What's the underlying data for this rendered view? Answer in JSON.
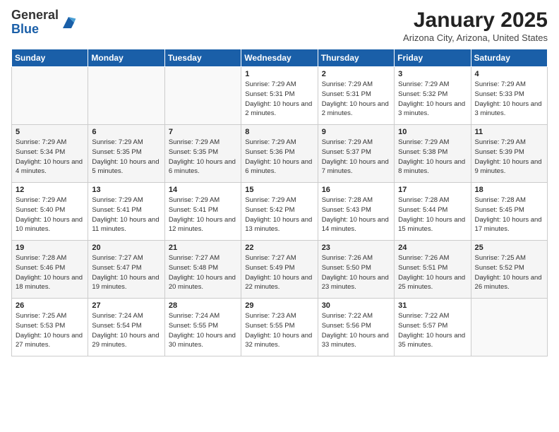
{
  "logo": {
    "general": "General",
    "blue": "Blue"
  },
  "title": "January 2025",
  "subtitle": "Arizona City, Arizona, United States",
  "headers": [
    "Sunday",
    "Monday",
    "Tuesday",
    "Wednesday",
    "Thursday",
    "Friday",
    "Saturday"
  ],
  "weeks": [
    [
      {
        "day": "",
        "sunrise": "",
        "sunset": "",
        "daylight": ""
      },
      {
        "day": "",
        "sunrise": "",
        "sunset": "",
        "daylight": ""
      },
      {
        "day": "",
        "sunrise": "",
        "sunset": "",
        "daylight": ""
      },
      {
        "day": "1",
        "sunrise": "Sunrise: 7:29 AM",
        "sunset": "Sunset: 5:31 PM",
        "daylight": "Daylight: 10 hours and 2 minutes."
      },
      {
        "day": "2",
        "sunrise": "Sunrise: 7:29 AM",
        "sunset": "Sunset: 5:31 PM",
        "daylight": "Daylight: 10 hours and 2 minutes."
      },
      {
        "day": "3",
        "sunrise": "Sunrise: 7:29 AM",
        "sunset": "Sunset: 5:32 PM",
        "daylight": "Daylight: 10 hours and 3 minutes."
      },
      {
        "day": "4",
        "sunrise": "Sunrise: 7:29 AM",
        "sunset": "Sunset: 5:33 PM",
        "daylight": "Daylight: 10 hours and 3 minutes."
      }
    ],
    [
      {
        "day": "5",
        "sunrise": "Sunrise: 7:29 AM",
        "sunset": "Sunset: 5:34 PM",
        "daylight": "Daylight: 10 hours and 4 minutes."
      },
      {
        "day": "6",
        "sunrise": "Sunrise: 7:29 AM",
        "sunset": "Sunset: 5:35 PM",
        "daylight": "Daylight: 10 hours and 5 minutes."
      },
      {
        "day": "7",
        "sunrise": "Sunrise: 7:29 AM",
        "sunset": "Sunset: 5:35 PM",
        "daylight": "Daylight: 10 hours and 6 minutes."
      },
      {
        "day": "8",
        "sunrise": "Sunrise: 7:29 AM",
        "sunset": "Sunset: 5:36 PM",
        "daylight": "Daylight: 10 hours and 6 minutes."
      },
      {
        "day": "9",
        "sunrise": "Sunrise: 7:29 AM",
        "sunset": "Sunset: 5:37 PM",
        "daylight": "Daylight: 10 hours and 7 minutes."
      },
      {
        "day": "10",
        "sunrise": "Sunrise: 7:29 AM",
        "sunset": "Sunset: 5:38 PM",
        "daylight": "Daylight: 10 hours and 8 minutes."
      },
      {
        "day": "11",
        "sunrise": "Sunrise: 7:29 AM",
        "sunset": "Sunset: 5:39 PM",
        "daylight": "Daylight: 10 hours and 9 minutes."
      }
    ],
    [
      {
        "day": "12",
        "sunrise": "Sunrise: 7:29 AM",
        "sunset": "Sunset: 5:40 PM",
        "daylight": "Daylight: 10 hours and 10 minutes."
      },
      {
        "day": "13",
        "sunrise": "Sunrise: 7:29 AM",
        "sunset": "Sunset: 5:41 PM",
        "daylight": "Daylight: 10 hours and 11 minutes."
      },
      {
        "day": "14",
        "sunrise": "Sunrise: 7:29 AM",
        "sunset": "Sunset: 5:41 PM",
        "daylight": "Daylight: 10 hours and 12 minutes."
      },
      {
        "day": "15",
        "sunrise": "Sunrise: 7:29 AM",
        "sunset": "Sunset: 5:42 PM",
        "daylight": "Daylight: 10 hours and 13 minutes."
      },
      {
        "day": "16",
        "sunrise": "Sunrise: 7:28 AM",
        "sunset": "Sunset: 5:43 PM",
        "daylight": "Daylight: 10 hours and 14 minutes."
      },
      {
        "day": "17",
        "sunrise": "Sunrise: 7:28 AM",
        "sunset": "Sunset: 5:44 PM",
        "daylight": "Daylight: 10 hours and 15 minutes."
      },
      {
        "day": "18",
        "sunrise": "Sunrise: 7:28 AM",
        "sunset": "Sunset: 5:45 PM",
        "daylight": "Daylight: 10 hours and 17 minutes."
      }
    ],
    [
      {
        "day": "19",
        "sunrise": "Sunrise: 7:28 AM",
        "sunset": "Sunset: 5:46 PM",
        "daylight": "Daylight: 10 hours and 18 minutes."
      },
      {
        "day": "20",
        "sunrise": "Sunrise: 7:27 AM",
        "sunset": "Sunset: 5:47 PM",
        "daylight": "Daylight: 10 hours and 19 minutes."
      },
      {
        "day": "21",
        "sunrise": "Sunrise: 7:27 AM",
        "sunset": "Sunset: 5:48 PM",
        "daylight": "Daylight: 10 hours and 20 minutes."
      },
      {
        "day": "22",
        "sunrise": "Sunrise: 7:27 AM",
        "sunset": "Sunset: 5:49 PM",
        "daylight": "Daylight: 10 hours and 22 minutes."
      },
      {
        "day": "23",
        "sunrise": "Sunrise: 7:26 AM",
        "sunset": "Sunset: 5:50 PM",
        "daylight": "Daylight: 10 hours and 23 minutes."
      },
      {
        "day": "24",
        "sunrise": "Sunrise: 7:26 AM",
        "sunset": "Sunset: 5:51 PM",
        "daylight": "Daylight: 10 hours and 25 minutes."
      },
      {
        "day": "25",
        "sunrise": "Sunrise: 7:25 AM",
        "sunset": "Sunset: 5:52 PM",
        "daylight": "Daylight: 10 hours and 26 minutes."
      }
    ],
    [
      {
        "day": "26",
        "sunrise": "Sunrise: 7:25 AM",
        "sunset": "Sunset: 5:53 PM",
        "daylight": "Daylight: 10 hours and 27 minutes."
      },
      {
        "day": "27",
        "sunrise": "Sunrise: 7:24 AM",
        "sunset": "Sunset: 5:54 PM",
        "daylight": "Daylight: 10 hours and 29 minutes."
      },
      {
        "day": "28",
        "sunrise": "Sunrise: 7:24 AM",
        "sunset": "Sunset: 5:55 PM",
        "daylight": "Daylight: 10 hours and 30 minutes."
      },
      {
        "day": "29",
        "sunrise": "Sunrise: 7:23 AM",
        "sunset": "Sunset: 5:55 PM",
        "daylight": "Daylight: 10 hours and 32 minutes."
      },
      {
        "day": "30",
        "sunrise": "Sunrise: 7:22 AM",
        "sunset": "Sunset: 5:56 PM",
        "daylight": "Daylight: 10 hours and 33 minutes."
      },
      {
        "day": "31",
        "sunrise": "Sunrise: 7:22 AM",
        "sunset": "Sunset: 5:57 PM",
        "daylight": "Daylight: 10 hours and 35 minutes."
      },
      {
        "day": "",
        "sunrise": "",
        "sunset": "",
        "daylight": ""
      }
    ]
  ]
}
